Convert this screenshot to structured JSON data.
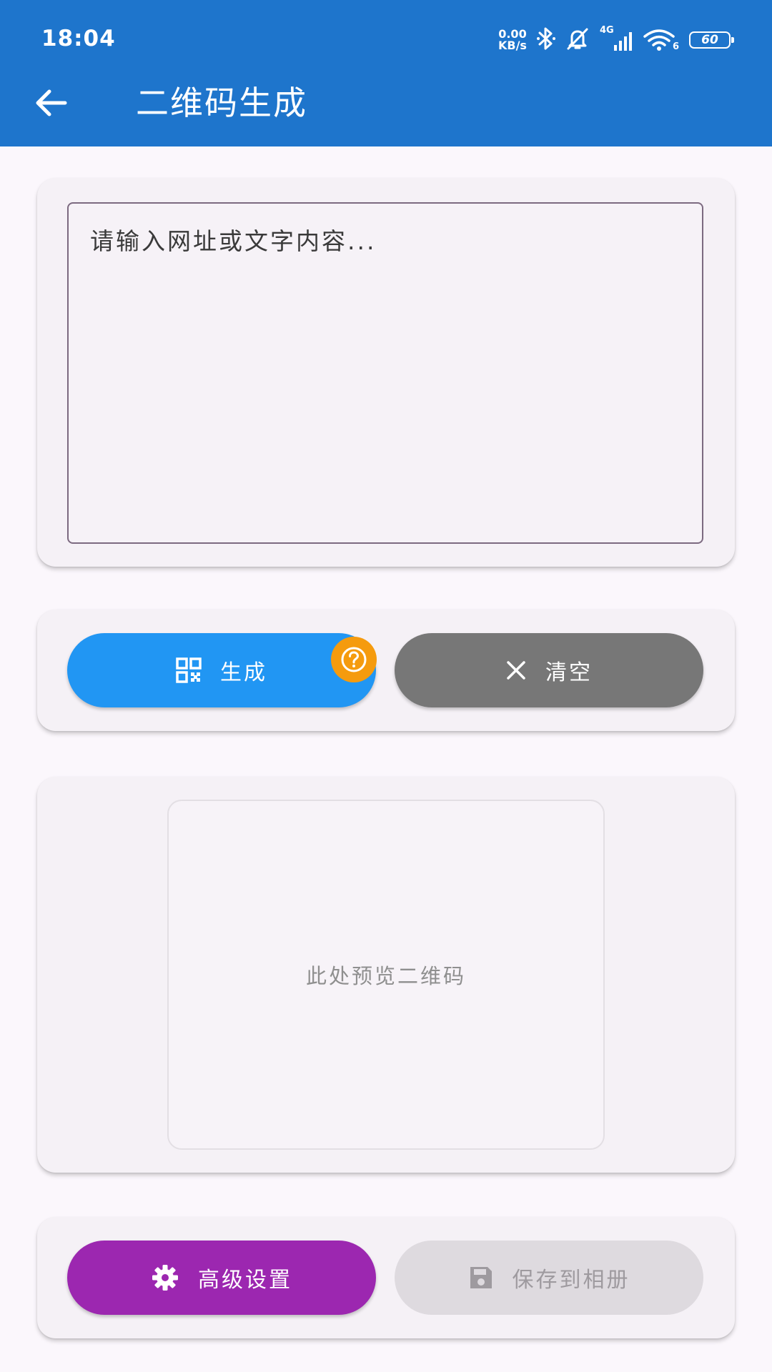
{
  "status_bar": {
    "time": "18:04",
    "net_speed_value": "0.00",
    "net_speed_unit": "KB/s",
    "signal_label": "4G",
    "wifi_label": "6",
    "battery": "60"
  },
  "app_bar": {
    "title": "二维码生成",
    "back_icon": "arrow-back-icon",
    "background_color": "#1e75cc"
  },
  "input": {
    "placeholder": "请输入网址或文字内容...",
    "value": ""
  },
  "actions": {
    "generate_label": "生成",
    "generate_icon": "qr-code-icon",
    "generate_color": "#2196f3",
    "help_icon": "help-circle-icon",
    "help_color": "#f59b0e",
    "clear_label": "清空",
    "clear_icon": "close-icon",
    "clear_color": "#777777"
  },
  "preview": {
    "placeholder_text": "此处预览二维码"
  },
  "bottom_actions": {
    "advanced_label": "高级设置",
    "advanced_icon": "gear-icon",
    "advanced_color": "#9c27b0",
    "save_label": "保存到相册",
    "save_icon": "save-icon",
    "save_color": "#dedadf"
  }
}
